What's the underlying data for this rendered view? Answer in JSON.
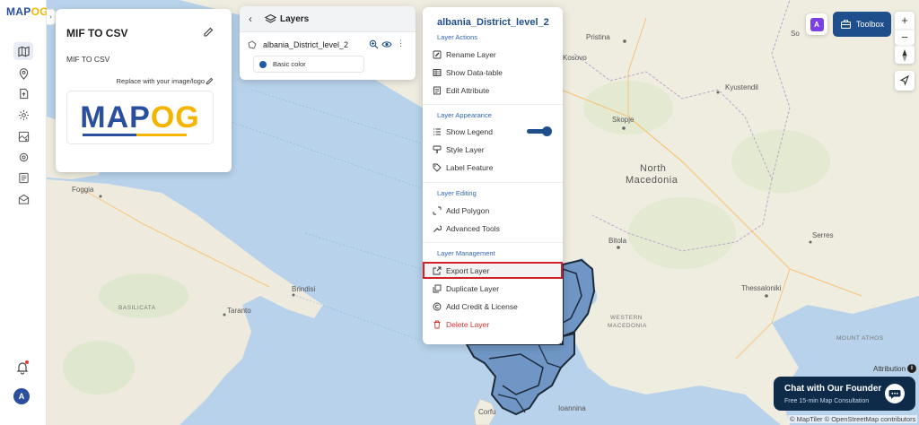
{
  "app": {
    "logo": "MAP",
    "logo_accent": "OG",
    "brand_colors": {
      "primary": "#1f4e8c",
      "accent": "#f4b400",
      "danger": "#d63031",
      "highlight": "#d42128"
    }
  },
  "sidebar": {
    "collapse_icon": "chevron-right-icon",
    "items": [
      {
        "name": "map-icon",
        "active": true
      },
      {
        "name": "location-icon",
        "active": false
      },
      {
        "name": "upload-icon",
        "active": false
      },
      {
        "name": "settings-gear-icon",
        "active": false
      },
      {
        "name": "map-layers-icon",
        "active": false
      },
      {
        "name": "gear-icon",
        "active": false
      },
      {
        "name": "report-icon",
        "active": false
      },
      {
        "name": "mail-icon",
        "active": false
      }
    ],
    "avatar_initial": "A"
  },
  "project": {
    "title": "MIF TO CSV",
    "description": "MIF TO CSV",
    "replace_logo_text": "Replace with your image/logo",
    "logo_text": "MAP",
    "logo_accent": "OG"
  },
  "layers": {
    "title": "Layers",
    "layer_name": "albania_District_level_2",
    "style_label": "Basic color",
    "style_color": "#1f5aa6"
  },
  "menu": {
    "layer_name": "albania_District_level_2",
    "sections": {
      "actions": "Layer Actions",
      "appearance": "Layer Appearance",
      "editing": "Layer Editing",
      "management": "Layer Management"
    },
    "items": {
      "rename": "Rename Layer",
      "datatable": "Show Data-table",
      "edit_attr": "Edit Attribute",
      "legend": "Show Legend",
      "style": "Style Layer",
      "label": "Label Feature",
      "add_polygon": "Add Polygon",
      "advanced": "Advanced Tools",
      "export": "Export Layer",
      "duplicate": "Duplicate Layer",
      "credit": "Add Credit & License",
      "delete": "Delete Layer"
    },
    "show_legend_on": true
  },
  "toolbar": {
    "ai_label": "A",
    "toolbox_label": "Toolbox"
  },
  "map": {
    "labels": {
      "pristina": "Pristina",
      "so": "So",
      "kosovo": "Kosovo",
      "kyustendil": "Kyustendil",
      "skopje": "Skopje",
      "north": "North",
      "macedonia": "Macedonia",
      "foggia": "Foggia",
      "bitola": "Bitola",
      "serres": "Serres",
      "brindisi": "Brindisi",
      "basilicata": "BASILICATA",
      "taranto": "Taranto",
      "thessaloniki": "Thessaloniki",
      "western1": "WESTERN",
      "western2": "MACEDONIA",
      "mount_athos": "MOUNT ATHOS",
      "corfu": "Corfu",
      "ioannina": "Ioannina"
    },
    "attribution": "Attribution",
    "credits": "© MapTiler © OpenStreetMap contributors"
  },
  "chat": {
    "title": "Chat with Our Founder",
    "subtitle": "Free 15-min Map Consultation"
  }
}
